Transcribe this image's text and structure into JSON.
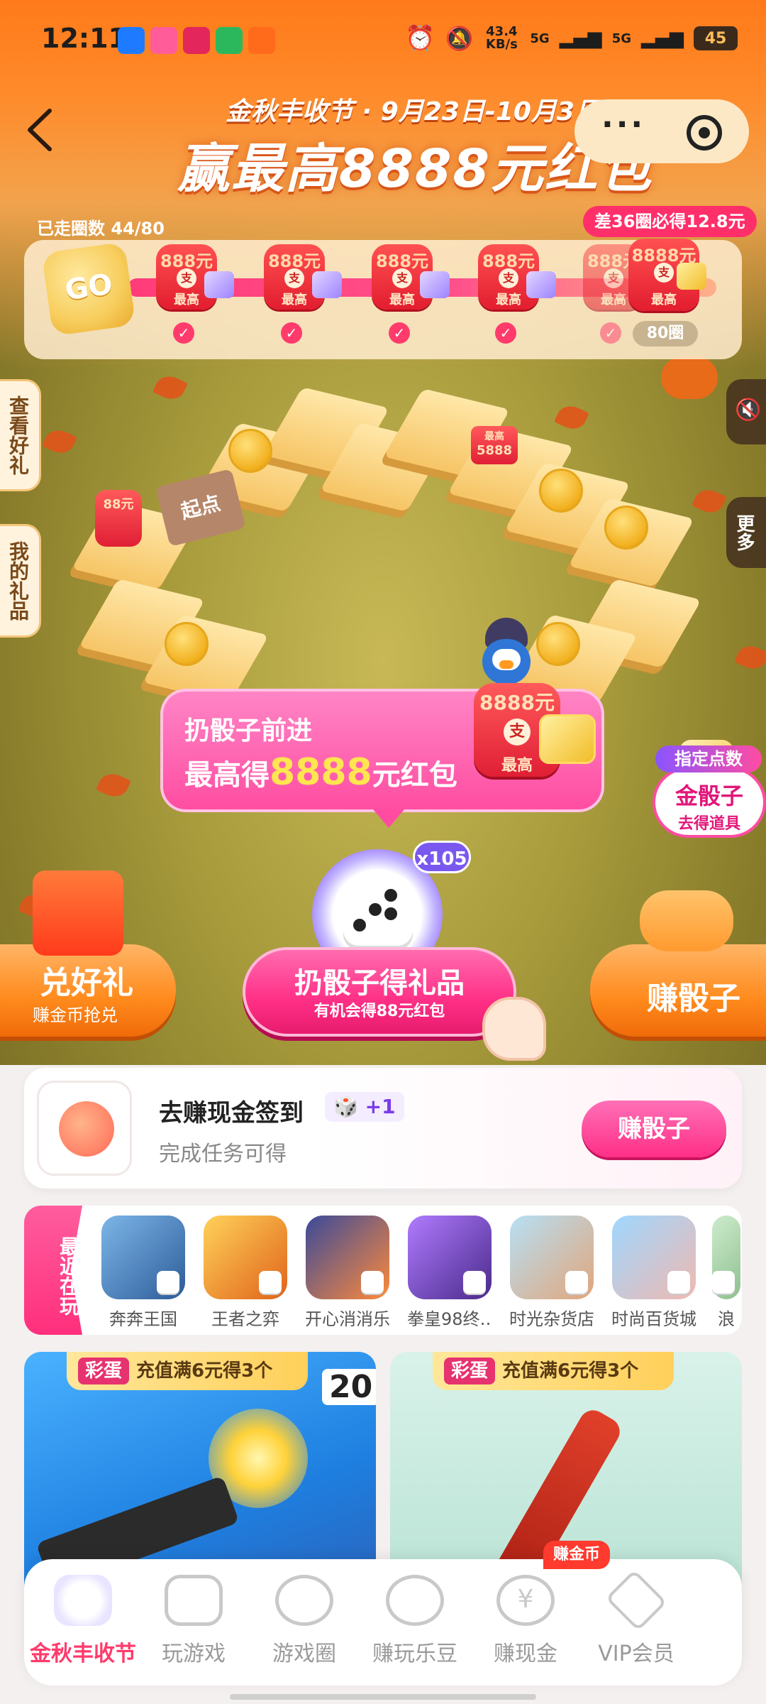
{
  "status_bar": {
    "time": "12:11",
    "net_speed": "43.4 KB/s",
    "network_1": "5G",
    "network_2": "5G",
    "battery": "45"
  },
  "header": {
    "subtitle": "金秋丰收节 · 9月23日-10月3日",
    "main_title": "赢最高8888元红包"
  },
  "progress": {
    "laps_label": "已走圈数 44/80",
    "need_badge": "差36圈必得12.8元",
    "go_label": "GO",
    "reward_amount": "888元",
    "reward_seal": "支",
    "reward_max": "最高",
    "final_reward_amount": "8888元",
    "final_lap": "80圈"
  },
  "side": {
    "view_gifts": "查看好礼",
    "my_gifts": "我的礼品",
    "more": "更多"
  },
  "board": {
    "start_tile": "起点",
    "tile_reward_max": "最高",
    "tile_reward_value": "5888",
    "left_reward_amount": "88元"
  },
  "bubble": {
    "line1": "扔骰子前进",
    "line2_prefix": "最高得",
    "line2_value": "8888",
    "line2_suffix": "元红包",
    "reward_amount": "8888元",
    "reward_seal": "支",
    "reward_max": "最高"
  },
  "dice": {
    "count": "x105",
    "roll_title": "扔骰子得礼品",
    "roll_sub": "有机会得88元红包"
  },
  "gold_dice": {
    "assign": "指定点数",
    "title": "金骰子",
    "sub": "去得道具"
  },
  "left_button": {
    "title": "兑好礼",
    "sub": "赚金币抢兑"
  },
  "right_button": {
    "title": "赚骰子"
  },
  "task": {
    "title": "去赚现金签到",
    "plus": "+1",
    "sub": "完成任务可得",
    "button": "赚骰子"
  },
  "recent": {
    "tag": "最近在玩",
    "games": [
      "奔奔王国",
      "王者之弈",
      "开心消消乐",
      "拳皇98终…",
      "时光杂货店",
      "时尚百货城",
      "浪"
    ]
  },
  "banners": [
    {
      "badge": "彩蛋",
      "text": "充值满6元得3个",
      "number": "20"
    },
    {
      "badge": "彩蛋",
      "text": "充值满6元得3个"
    }
  ],
  "nav": {
    "items": [
      "金秋丰收节",
      "玩游戏",
      "游戏圈",
      "赚玩乐豆",
      "赚现金",
      "VIP会员"
    ],
    "badge": "赚金币"
  },
  "colors": {
    "accent": "#ff2f86",
    "orange": "#ff8a1c",
    "active_nav": "#ff3b6c"
  }
}
